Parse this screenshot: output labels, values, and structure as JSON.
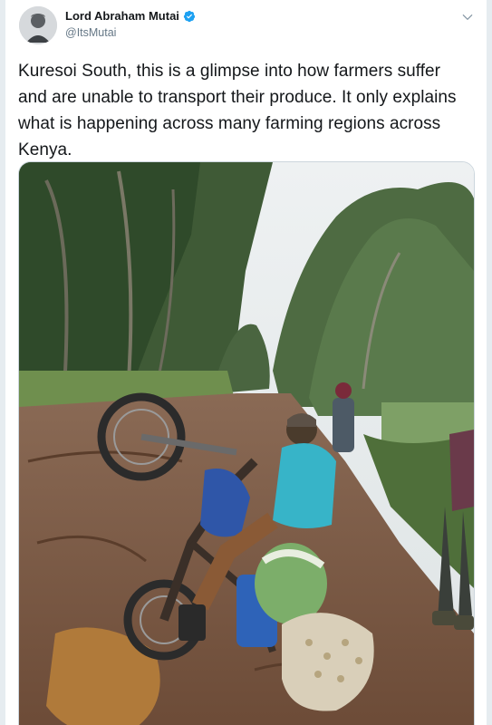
{
  "tweet": {
    "author": {
      "display_name": "Lord Abraham Mutai",
      "handle": "@ItsMutai",
      "verified": true,
      "avatar_icon": "user-avatar"
    },
    "text": "Kuresoi South, this is a glimpse into how farmers suffer and are unable to transport their produce. It only explains what is happening across many farming regions across Kenya.",
    "media": {
      "type": "photo"
    }
  },
  "colors": {
    "verified_blue": "#1da1f2",
    "text_primary": "#14171a",
    "text_secondary": "#657786",
    "border": "#e6ecf0"
  }
}
